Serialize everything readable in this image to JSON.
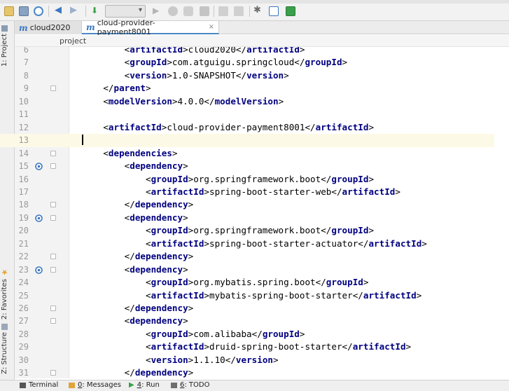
{
  "tabs": [
    {
      "label": "cloud2020",
      "active": false
    },
    {
      "label": "cloud-provider-payment8001",
      "active": true,
      "close": "×"
    }
  ],
  "breadcrumb": "project",
  "left_tools": {
    "project": "1: Project",
    "favorites": "2: Favorites",
    "structure": "Z: Structure"
  },
  "editor": {
    "caret_line": 13,
    "lines": [
      {
        "num": "6",
        "indent": 2,
        "tag": "artifactId",
        "text": "cloud2020",
        "close": true
      },
      {
        "num": "7",
        "indent": 2,
        "tag": "groupId",
        "text": "com.atguigu.springcloud",
        "close": true
      },
      {
        "num": "8",
        "indent": 2,
        "tag": "version",
        "text": "1.0-SNAPSHOT",
        "close": true
      },
      {
        "num": "9",
        "indent": 1,
        "closing": "parent"
      },
      {
        "num": "10",
        "indent": 1,
        "tag": "modelVersion",
        "text": "4.0.0",
        "close": true
      },
      {
        "num": "11"
      },
      {
        "num": "12",
        "indent": 1,
        "tag": "artifactId",
        "text": "cloud-provider-payment8001",
        "close": true
      },
      {
        "num": "13",
        "cursor": true
      },
      {
        "num": "14",
        "indent": 1,
        "open": "dependencies"
      },
      {
        "num": "15",
        "indent": 2,
        "open": "dependency",
        "marker": true
      },
      {
        "num": "16",
        "indent": 3,
        "tag": "groupId",
        "text": "org.springframework.boot",
        "close": true
      },
      {
        "num": "17",
        "indent": 3,
        "tag": "artifactId",
        "text": "spring-boot-starter-web",
        "close": true
      },
      {
        "num": "18",
        "indent": 2,
        "closing": "dependency"
      },
      {
        "num": "19",
        "indent": 2,
        "open": "dependency",
        "marker": true
      },
      {
        "num": "20",
        "indent": 3,
        "tag": "groupId",
        "text": "org.springframework.boot",
        "close": true
      },
      {
        "num": "21",
        "indent": 3,
        "tag": "artifactId",
        "text": "spring-boot-starter-actuator",
        "close": true
      },
      {
        "num": "22",
        "indent": 2,
        "closing": "dependency"
      },
      {
        "num": "23",
        "indent": 2,
        "open": "dependency",
        "marker": true
      },
      {
        "num": "24",
        "indent": 3,
        "tag": "groupId",
        "text": "org.mybatis.spring.boot",
        "close": true
      },
      {
        "num": "25",
        "indent": 3,
        "tag": "artifactId",
        "text": "mybatis-spring-boot-starter",
        "close": true
      },
      {
        "num": "26",
        "indent": 2,
        "closing": "dependency"
      },
      {
        "num": "27",
        "indent": 2,
        "open": "dependency"
      },
      {
        "num": "28",
        "indent": 3,
        "tag": "groupId",
        "text": "com.alibaba",
        "close": true
      },
      {
        "num": "29",
        "indent": 3,
        "tag": "artifactId",
        "text": "druid-spring-boot-starter",
        "close": true
      },
      {
        "num": "30",
        "indent": 3,
        "tag": "version",
        "text": "1.1.10",
        "close": true
      },
      {
        "num": "31",
        "indent": 2,
        "closing": "dependency"
      }
    ]
  },
  "statusbar": {
    "terminal": "Terminal",
    "messages_key": "0",
    "messages": ": Messages",
    "run_key": "4",
    "run": ": Run",
    "todo_key": "6",
    "todo": ": TODO"
  },
  "colors": {
    "tag": "#000080",
    "gutter_marker": "#3b77c2",
    "run_green": "#3aa04a"
  }
}
